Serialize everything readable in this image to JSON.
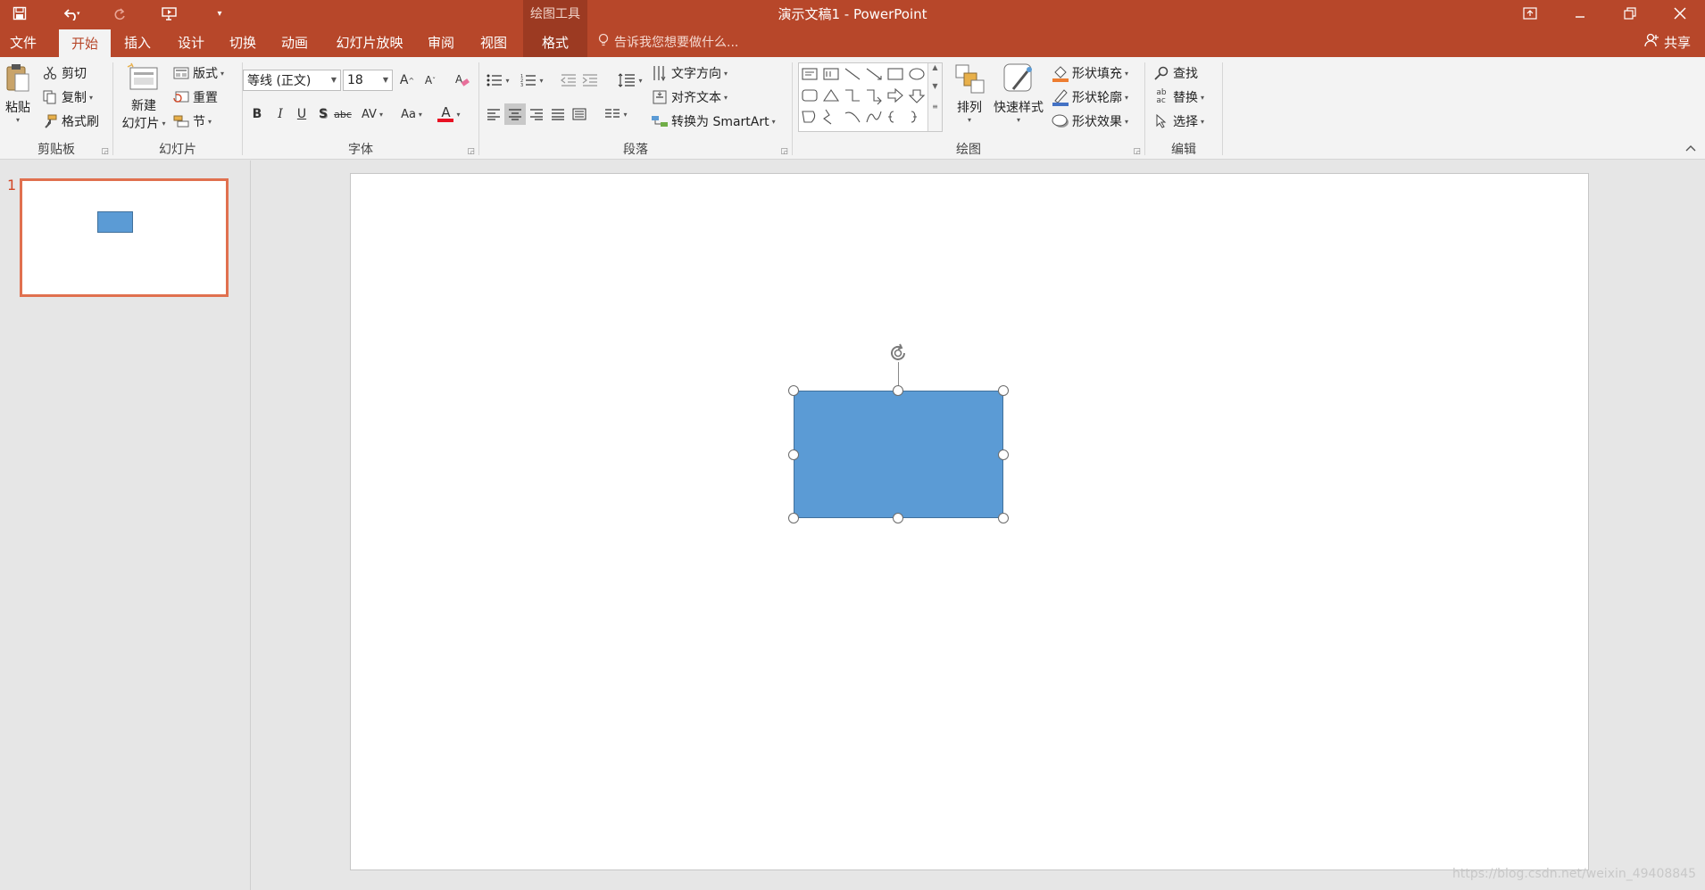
{
  "app": {
    "document_title": "演示文稿1  -  PowerPoint",
    "context_tool_title": "绘图工具"
  },
  "tabs": [
    {
      "label": "文件"
    },
    {
      "label": "开始",
      "active": true
    },
    {
      "label": "插入"
    },
    {
      "label": "设计"
    },
    {
      "label": "切换"
    },
    {
      "label": "动画"
    },
    {
      "label": "幻灯片放映"
    },
    {
      "label": "审阅"
    },
    {
      "label": "视图"
    },
    {
      "label": "格式",
      "contextual": true
    }
  ],
  "tellme": {
    "placeholder": "告诉我您想要做什么..."
  },
  "share": {
    "label": "共享"
  },
  "ribbon": {
    "clipboard": {
      "group_label": "剪贴板",
      "paste": "粘贴",
      "cut": "剪切",
      "copy": "复制",
      "format_painter": "格式刷"
    },
    "slides": {
      "group_label": "幻灯片",
      "new_slide_line1": "新建",
      "new_slide_line2": "幻灯片",
      "layout": "版式",
      "reset": "重置",
      "section": "节"
    },
    "font": {
      "group_label": "字体",
      "font_name": "等线 (正文)",
      "font_size": "18",
      "bold": "B",
      "italic": "I",
      "underline": "U",
      "shadow": "S",
      "strike": "abc",
      "spacing": "AV",
      "case": "Aa",
      "color_letter": "A",
      "grow": "A",
      "shrink": "A"
    },
    "paragraph": {
      "group_label": "段落",
      "text_direction": "文字方向",
      "align_text": "对齐文本",
      "smartart": "转换为 SmartArt"
    },
    "drawing": {
      "group_label": "绘图",
      "arrange": "排列",
      "quick_styles": "快速样式",
      "shape_fill": "形状填充",
      "shape_outline": "形状轮廓",
      "shape_effects": "形状效果"
    },
    "editing": {
      "group_label": "编辑",
      "find": "查找",
      "replace": "替换",
      "select": "选择"
    }
  },
  "thumbnails": [
    {
      "number": "1"
    }
  ],
  "colors": {
    "accent": "#b7472a",
    "shape_fill": "#5b9bd5",
    "shape_border": "#41719c"
  },
  "watermark": "https://blog.csdn.net/weixin_49408845"
}
